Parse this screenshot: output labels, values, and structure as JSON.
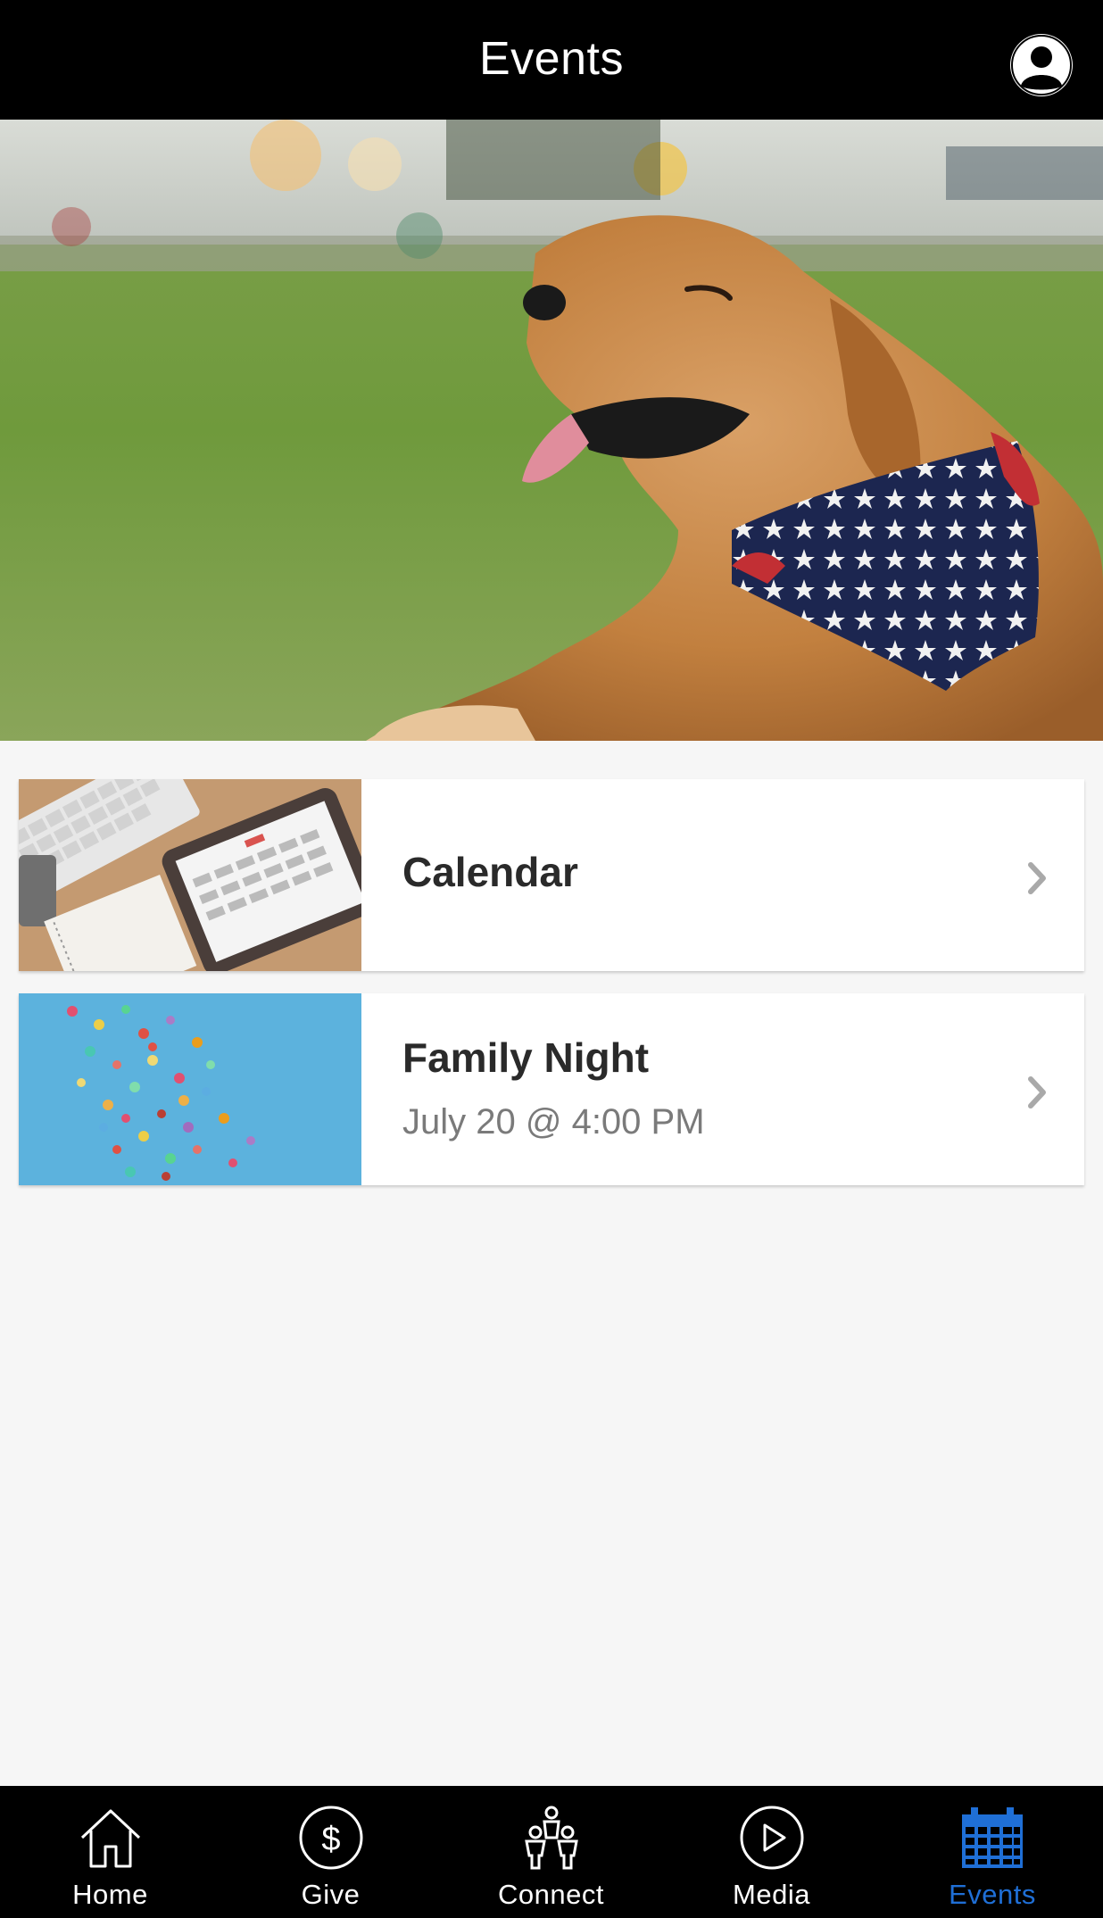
{
  "header": {
    "title": "Events",
    "profile_icon": "user-icon"
  },
  "events": [
    {
      "title": "Calendar",
      "subtitle": "",
      "thumbnail": "keyboard-and-tablet-calendar"
    },
    {
      "title": "Family Night",
      "subtitle": "July 20 @ 4:00 PM",
      "thumbnail": "colorful-balloons"
    }
  ],
  "tabs": [
    {
      "label": "Home",
      "icon": "home-icon",
      "active": false
    },
    {
      "label": "Give",
      "icon": "dollar-circle-icon",
      "active": false
    },
    {
      "label": "Connect",
      "icon": "people-icon",
      "active": false
    },
    {
      "label": "Media",
      "icon": "play-circle-icon",
      "active": false
    },
    {
      "label": "Events",
      "icon": "calendar-icon",
      "active": true
    }
  ],
  "colors": {
    "header_bg": "#000000",
    "tabbar_bg": "#000000",
    "active_tab": "#1f6fd6",
    "page_bg": "#f6f6f6"
  }
}
